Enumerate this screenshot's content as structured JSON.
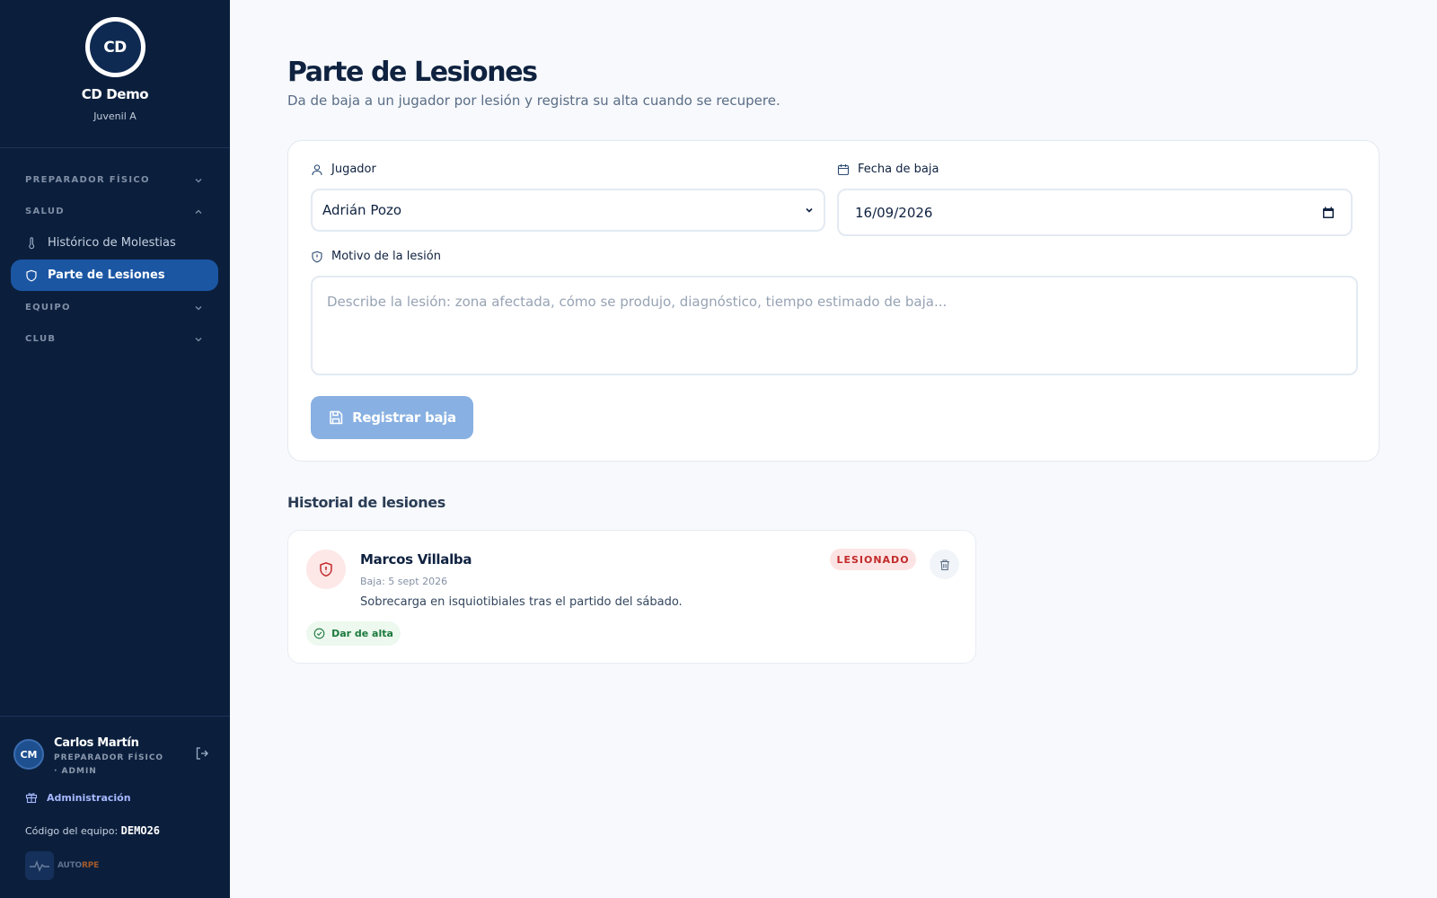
{
  "sidebar": {
    "brand_initials": "CD",
    "brand_name": "CD Demo",
    "brand_subtitle": "Juvenil A",
    "sections": [
      {
        "label": "PREPARADOR FÍSICO",
        "expanded": false
      },
      {
        "label": "SALUD",
        "expanded": true
      },
      {
        "label": "EQUIPO",
        "expanded": false
      },
      {
        "label": "CLUB",
        "expanded": false
      }
    ],
    "items": [
      {
        "label": "Histórico de Molestias",
        "icon": "thermometer-icon"
      },
      {
        "label": "Parte de Lesiones",
        "icon": "shield-icon",
        "active": true
      }
    ],
    "user": {
      "initials": "CM",
      "name": "Carlos Martín",
      "role": "PREPARADOR FÍSICO · ADMIN"
    },
    "admin_label": "Administración",
    "team_code_label": "Código del equipo:",
    "team_code": "DEMO26",
    "powered_prefix": "AUTO",
    "powered_suffix": "RPE"
  },
  "main": {
    "title": "Parte de Lesiones",
    "subtitle": "Da de baja a un jugador por lesión y registra su alta cuando se recupere.",
    "form": {
      "player_label": "Jugador",
      "player_value": "Adrián Pozo",
      "date_label": "Fecha de baja",
      "date_value": "16/09/2026",
      "reason_label": "Motivo de la lesión",
      "reason_placeholder": "Describe la lesión: zona afectada, cómo se produjo, diagnóstico, tiempo estimado de baja...",
      "submit_label": "Registrar baja"
    },
    "history": {
      "title": "Historial de lesiones",
      "entries": [
        {
          "player": "Marcos Villalba",
          "date": "Baja: 5 sept 2026",
          "description": "Sobrecarga en isquiotibiales tras el partido del sábado.",
          "status": "LESIONADO",
          "action": "Dar de alta"
        }
      ]
    }
  },
  "colors": {
    "sidebar_bg": "#0b1f3d",
    "accent": "#1b56a3",
    "danger": "#c22a2a",
    "success": "#1b7a3d"
  }
}
